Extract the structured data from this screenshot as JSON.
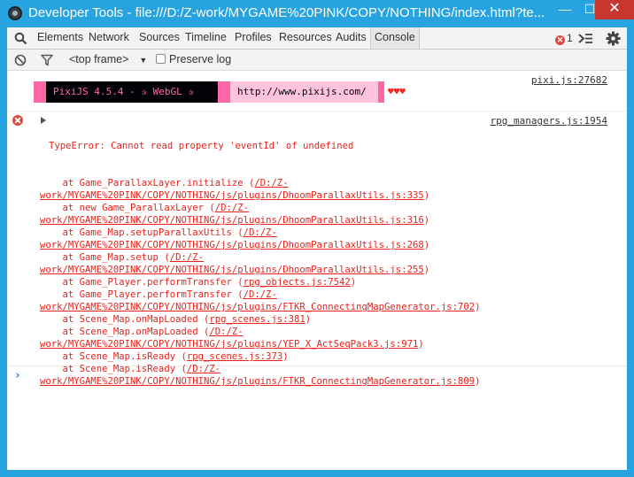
{
  "window": {
    "title": "Developer Tools - file:///D:/Z-work/MYGAME%20PINK/COPY/NOTHING/index.html?te...",
    "minimize_glyph": "—",
    "maximize_glyph": "☐",
    "close_glyph": "✕"
  },
  "tabs": [
    {
      "label": "Elements"
    },
    {
      "label": "Network"
    },
    {
      "label": "Sources"
    },
    {
      "label": "Timeline"
    },
    {
      "label": "Profiles"
    },
    {
      "label": "Resources"
    },
    {
      "label": "Audits"
    },
    {
      "label": "Console"
    }
  ],
  "error_count": "1",
  "console_toolbar": {
    "frame_select": "<top frame>",
    "frame_arrow": "▼",
    "preserve_log_label": "Preserve log"
  },
  "pixi_message": {
    "source": "pixi.js:27682",
    "banner_main": "PixiJS 4.5.4 - ✰ WebGL ✰",
    "banner_url": "http://www.pixijs.com/",
    "hearts": "♥♥♥"
  },
  "error_message": {
    "source": "rpg_managers.js:1954",
    "title": "TypeError: Cannot read property 'eventId' of undefined",
    "lines": [
      {
        "pre": "    at Game_ParallaxLayer.initialize (",
        "link": "/D:/Z-",
        "post": ""
      },
      {
        "pre": "",
        "link": "work/MYGAME%20PINK/COPY/NOTHING/js/plugins/DhoomParallaxUtils.js:335",
        "post": ")"
      },
      {
        "pre": "    at new Game_ParallaxLayer (",
        "link": "/D:/Z-",
        "post": ""
      },
      {
        "pre": "",
        "link": "work/MYGAME%20PINK/COPY/NOTHING/js/plugins/DhoomParallaxUtils.js:316",
        "post": ")"
      },
      {
        "pre": "    at Game_Map.setupParallaxUtils (",
        "link": "/D:/Z-",
        "post": ""
      },
      {
        "pre": "",
        "link": "work/MYGAME%20PINK/COPY/NOTHING/js/plugins/DhoomParallaxUtils.js:268",
        "post": ")"
      },
      {
        "pre": "    at Game_Map.setup (",
        "link": "/D:/Z-",
        "post": ""
      },
      {
        "pre": "",
        "link": "work/MYGAME%20PINK/COPY/NOTHING/js/plugins/DhoomParallaxUtils.js:255",
        "post": ")"
      },
      {
        "pre": "    at Game_Player.performTransfer (",
        "link": "rpg_objects.js:7542",
        "post": ")"
      },
      {
        "pre": "    at Game_Player.performTransfer (",
        "link": "/D:/Z-",
        "post": ""
      },
      {
        "pre": "",
        "link": "work/MYGAME%20PINK/COPY/NOTHING/js/plugins/FTKR_ConnectingMapGenerator.js:702",
        "post": ")"
      },
      {
        "pre": "    at Scene_Map.onMapLoaded (",
        "link": "rpg_scenes.js:381",
        "post": ")"
      },
      {
        "pre": "    at Scene_Map.onMapLoaded (",
        "link": "/D:/Z-",
        "post": ""
      },
      {
        "pre": "",
        "link": "work/MYGAME%20PINK/COPY/NOTHING/js/plugins/YEP_X_ActSeqPack3.js:971",
        "post": ")"
      },
      {
        "pre": "    at Scene_Map.isReady (",
        "link": "rpg_scenes.js:373",
        "post": ")"
      },
      {
        "pre": "    at Scene_Map.isReady (",
        "link": "/D:/Z-",
        "post": ""
      },
      {
        "pre": "",
        "link": "work/MYGAME%20PINK/COPY/NOTHING/js/plugins/FTKR_ConnectingMapGenerator.js:809",
        "post": ")"
      }
    ]
  },
  "prompt_glyph": "›",
  "colors": {
    "frame": "#27a3e0",
    "error_text": "#e8231d",
    "pixi_pink": "#ff66a5",
    "pixi_light": "#ffc3dc",
    "close_button": "#c7362f",
    "prompt": "#2d7cd6"
  }
}
